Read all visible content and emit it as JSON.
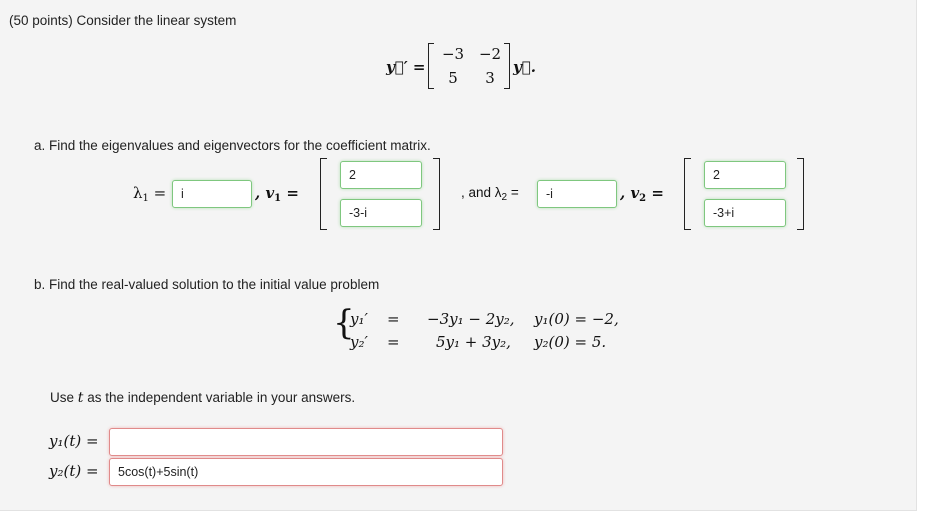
{
  "problem": {
    "header": "(50 points) Consider the linear system",
    "system": {
      "lhs": "y⃗′ =",
      "matrix": [
        [
          "−3",
          "−2"
        ],
        [
          "5",
          "3"
        ]
      ],
      "rhs": "y⃗."
    },
    "part_a": {
      "prompt": "a. Find the eigenvalues and eigenvectors for the coefficient matrix.",
      "lambda1_label": "λ",
      "lambda1_sub": "1",
      "lambda1_value": "i",
      "v1_label": ", v",
      "v1_sub": "1",
      "v1_entries": [
        "2",
        "-3-i"
      ],
      "and_text": ", and λ",
      "lambda2_sub": "2",
      "lambda2_value": "-i",
      "v2_label": ", v",
      "v2_sub": "2",
      "v2_entries": [
        "2",
        "-3+i"
      ]
    },
    "part_b": {
      "prompt": "b. Find the real-valued solution to the initial value problem",
      "equations": [
        {
          "lhs": "y₁′",
          "eq": "=",
          "rhs": "−3y₁ − 2y₂,",
          "ic": "y₁(0) = −2,"
        },
        {
          "lhs": "y₂′",
          "eq": "=",
          "rhs": "5y₁ + 3y₂,",
          "ic": "y₂(0) = 5."
        }
      ],
      "instruction_pre": "Use",
      "instruction_var": "t",
      "instruction_post": "as the independent variable in your answers.",
      "y1_label": "y₁(t) =",
      "y1_value": "",
      "y2_label": "y₂(t) =",
      "y2_value": "5cos(t)+5sin(t)"
    }
  }
}
